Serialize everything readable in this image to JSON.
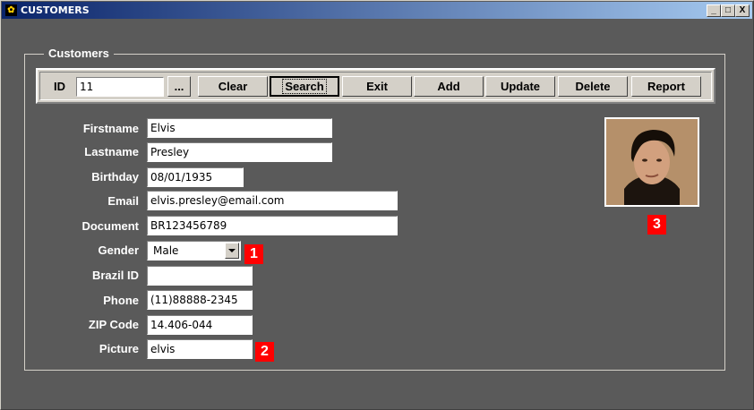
{
  "window": {
    "title": "CUSTOMERS",
    "controls": {
      "minimize": "_",
      "maximize": "□",
      "close": "X"
    }
  },
  "group": {
    "label": "Customers"
  },
  "toolbar": {
    "id_label": "ID",
    "id_value": "11",
    "browse_label": "...",
    "buttons": {
      "clear": "Clear",
      "search": "Search",
      "exit": "Exit",
      "add": "Add",
      "update": "Update",
      "delete": "Delete",
      "report": "Report"
    }
  },
  "form": {
    "firstname": {
      "label": "Firstname",
      "value": "Elvis"
    },
    "lastname": {
      "label": "Lastname",
      "value": "Presley"
    },
    "birthday": {
      "label": "Birthday",
      "value": "08/01/1935"
    },
    "email": {
      "label": "Email",
      "value": "elvis.presley@email.com"
    },
    "document": {
      "label": "Document",
      "value": "BR123456789"
    },
    "gender": {
      "label": "Gender",
      "value": "Male"
    },
    "brazil_id": {
      "label": "Brazil ID",
      "value": ""
    },
    "phone": {
      "label": "Phone",
      "value": "(11)88888-2345"
    },
    "zip": {
      "label": "ZIP Code",
      "value": "14.406-044"
    },
    "picture": {
      "label": "Picture",
      "value": "elvis"
    }
  },
  "badges": {
    "b1": "1",
    "b2": "2",
    "b3": "3"
  },
  "colors": {
    "background": "#5a5a5a",
    "titlebar_start": "#0a246a",
    "titlebar_end": "#a6caf0",
    "badge": "#ff0000",
    "button_face": "#d4d0c8"
  }
}
